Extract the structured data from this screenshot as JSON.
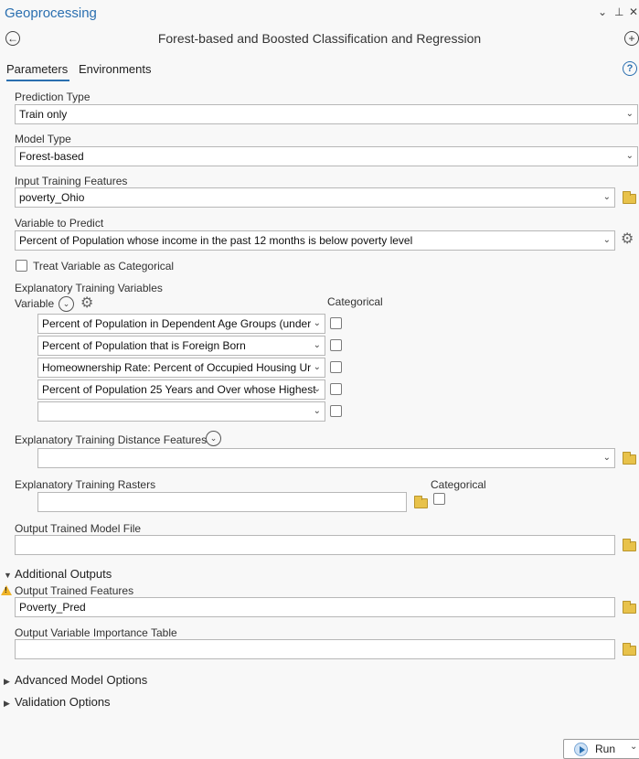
{
  "pane": {
    "title": "Geoprocessing",
    "ctrl_menu": "⌄",
    "ctrl_pin": "⊥",
    "ctrl_close": "✕"
  },
  "tool": {
    "title": "Forest-based and Boosted Classification and Regression"
  },
  "tabs": [
    {
      "label": "Parameters"
    },
    {
      "label": "Environments"
    }
  ],
  "params": {
    "prediction_type": {
      "label": "Prediction Type",
      "value": "Train only"
    },
    "model_type": {
      "label": "Model Type",
      "value": "Forest-based"
    },
    "input_training": {
      "label": "Input Training Features",
      "value": "poverty_Ohio"
    },
    "variable_predict": {
      "label": "Variable to Predict",
      "value": "Percent of Population whose income in the past 12 months is below poverty level"
    },
    "treat_categorical": {
      "label": "Treat Variable as Categorical"
    },
    "explanatory_vars": {
      "label": "Explanatory Training Variables",
      "col_variable": "Variable",
      "col_categorical": "Categorical",
      "rows": [
        {
          "value": "Percent of Population in Dependent Age Groups (under"
        },
        {
          "value": "Percent of Population that is Foreign Born"
        },
        {
          "value": "Homeownership Rate: Percent of Occupied Housing Ur"
        },
        {
          "value": "Percent of Population 25 Years and Over whose Highest"
        },
        {
          "value": ""
        }
      ]
    },
    "distance_features": {
      "label": "Explanatory Training Distance Features",
      "value": ""
    },
    "rasters": {
      "label": "Explanatory Training Rasters",
      "col_categorical": "Categorical",
      "value": ""
    },
    "output_model": {
      "label": "Output Trained Model File",
      "value": ""
    }
  },
  "sections": {
    "additional_outputs": "Additional Outputs",
    "advanced": "Advanced Model Options",
    "validation": "Validation Options"
  },
  "outputs": {
    "trained_features": {
      "label": "Output Trained Features",
      "value": "Poverty_Pred"
    },
    "importance_table": {
      "label": "Output Variable Importance Table",
      "value": ""
    }
  },
  "run": {
    "label": "Run"
  },
  "colors": {
    "accent": "#2a6fb0",
    "folder": "#e8c24a",
    "warning": "#f0b429"
  }
}
